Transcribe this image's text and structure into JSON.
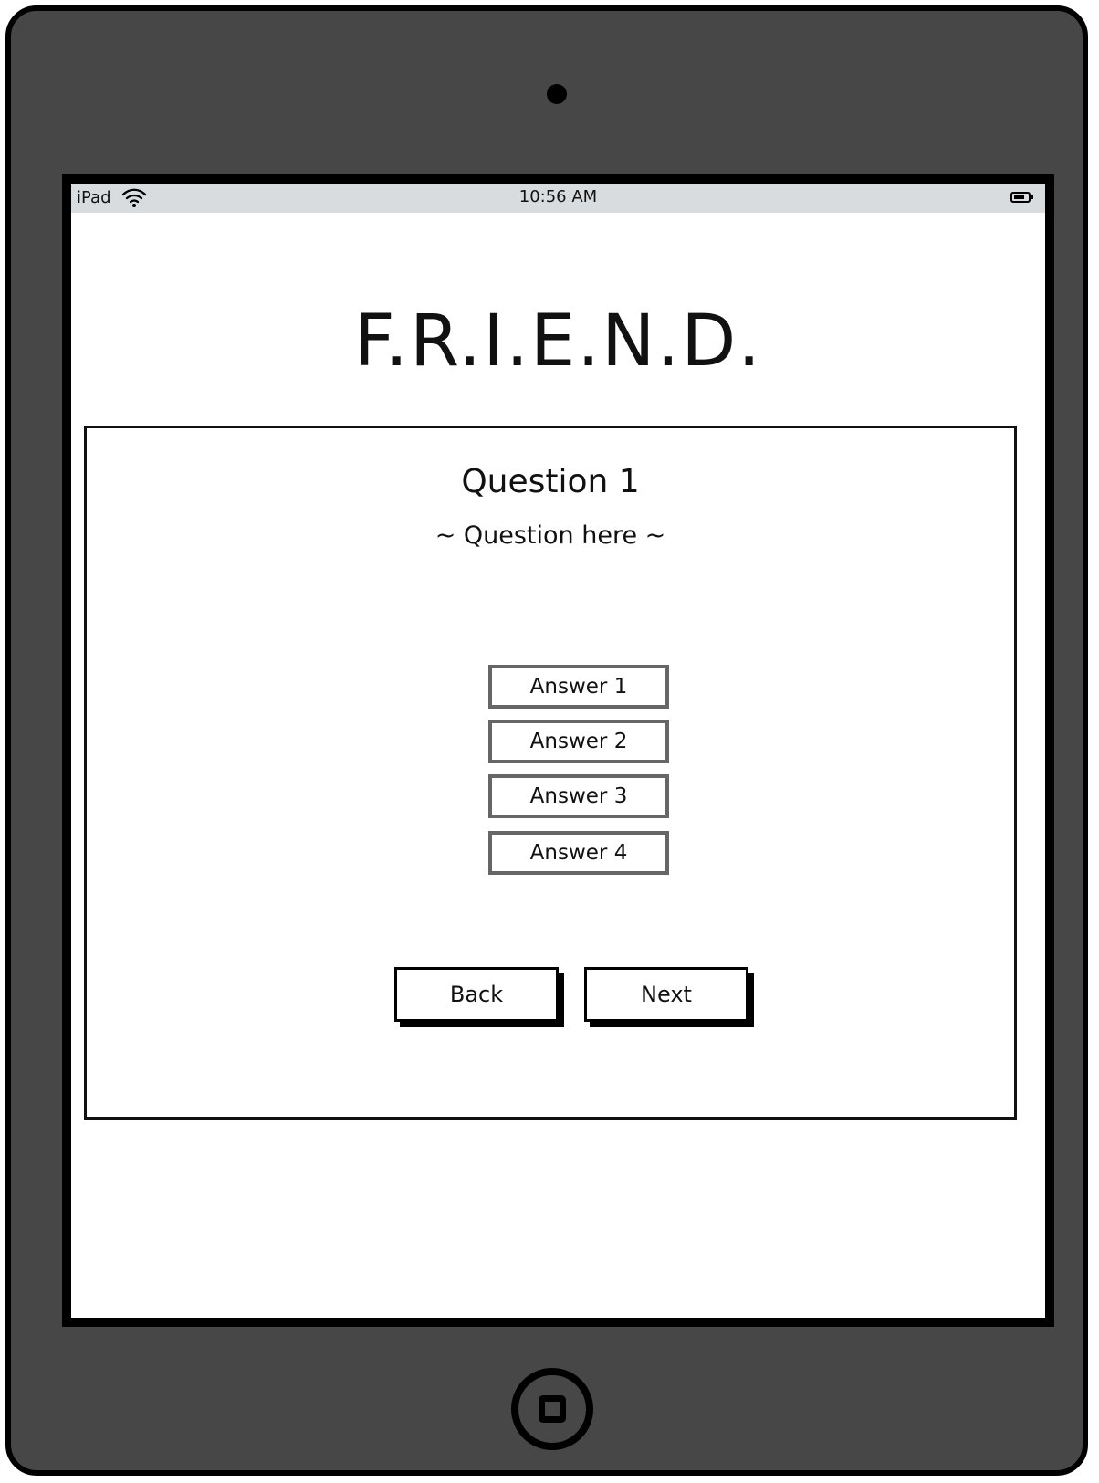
{
  "status_bar": {
    "device": "iPad",
    "time": "10:56 AM",
    "wifi_icon": "wifi-icon",
    "battery_icon": "battery-icon"
  },
  "app": {
    "title": "F.R.I.E.N.D."
  },
  "question": {
    "title": "Question 1",
    "text": "~ Question here ~"
  },
  "answers": [
    {
      "label": "Answer 1"
    },
    {
      "label": "Answer 2"
    },
    {
      "label": "Answer 3"
    },
    {
      "label": "Answer 4"
    }
  ],
  "navigation": {
    "back_label": "Back",
    "next_label": "Next"
  },
  "device": {
    "frame_color": "#474747",
    "status_bar_color": "#d8dcdf",
    "home_button_icon": "home-button-icon"
  }
}
